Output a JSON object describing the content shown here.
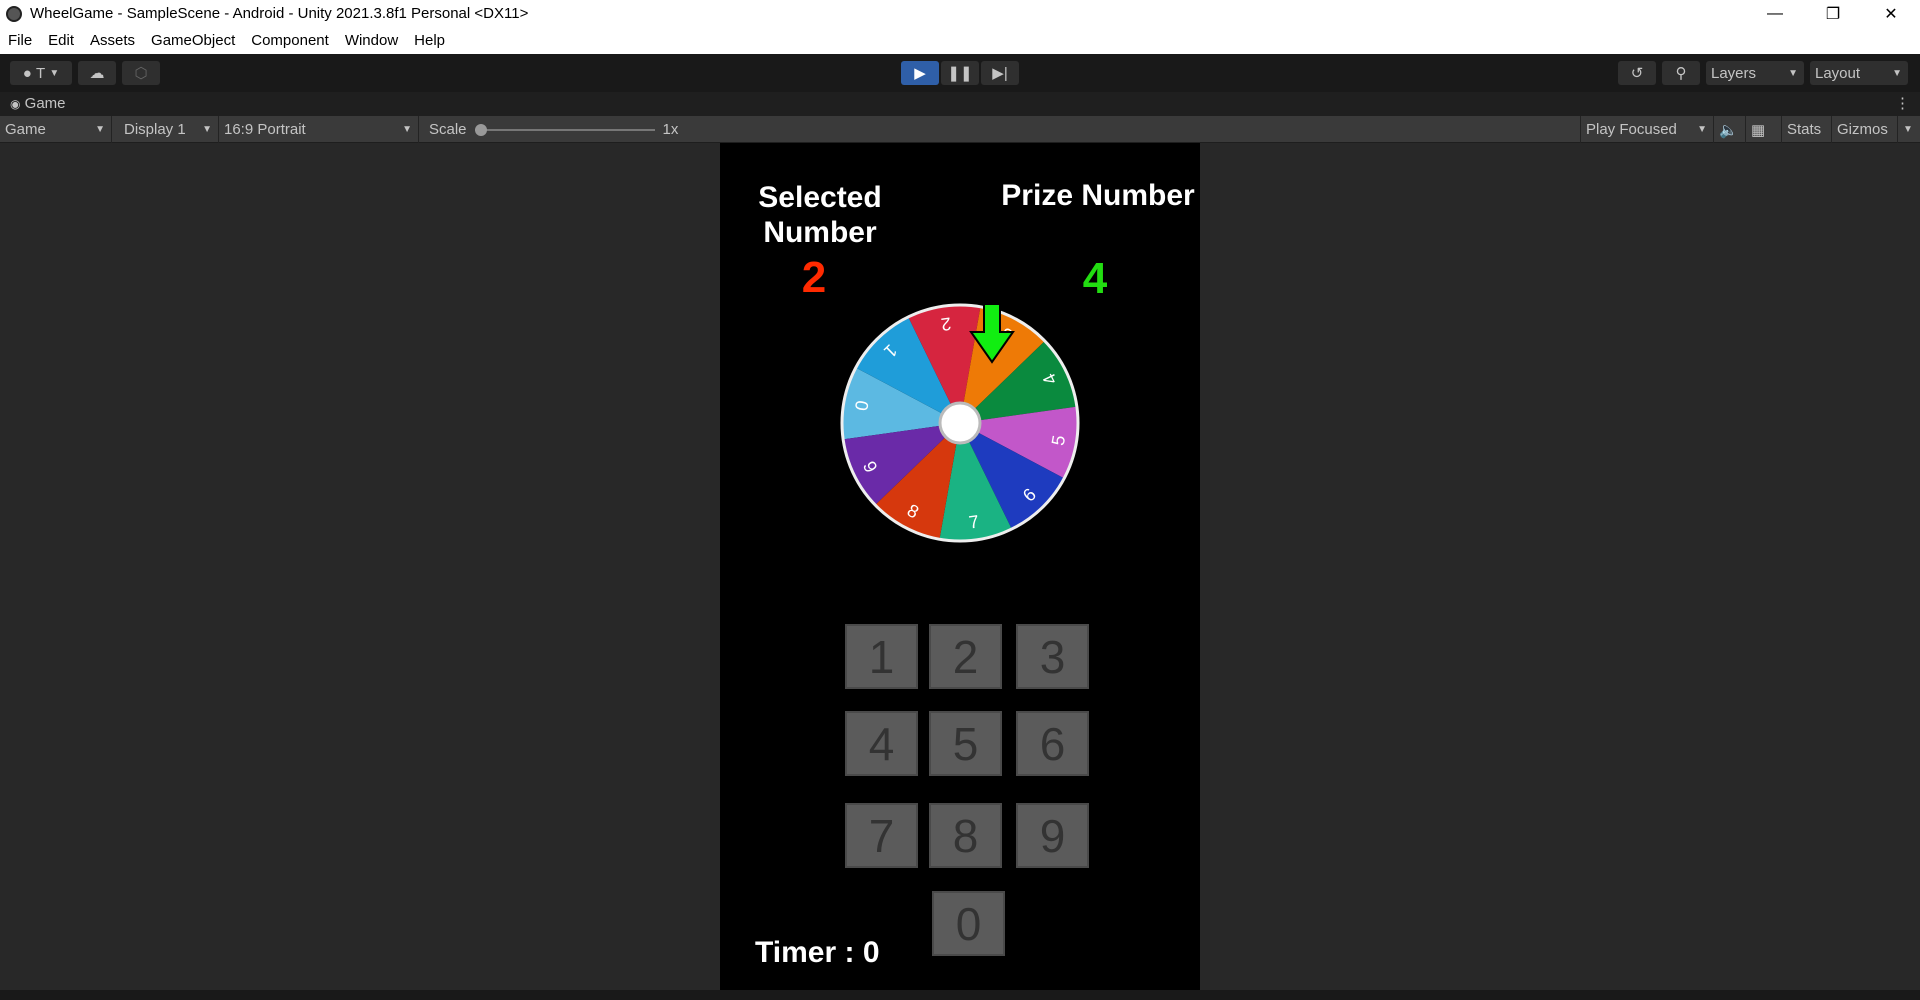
{
  "window": {
    "title": "WheelGame - SampleScene - Android - Unity 2021.3.8f1 Personal <DX11>"
  },
  "menu": [
    "File",
    "Edit",
    "Assets",
    "GameObject",
    "Component",
    "Window",
    "Help"
  ],
  "toolbar": {
    "account": "T",
    "layers": "Layers",
    "layout": "Layout"
  },
  "tab": {
    "label": "Game"
  },
  "game_toolbar": {
    "mode": "Game",
    "display": "Display 1",
    "aspect": "16:9 Portrait",
    "scale_label": "Scale",
    "scale_value": "1x",
    "play_focused": "Play Focused",
    "stats": "Stats",
    "gizmos": "Gizmos"
  },
  "game": {
    "selected_label": "Selected Number",
    "selected_value": "2",
    "prize_label": "Prize Number",
    "prize_value": "4",
    "timer": "Timer : 0",
    "wheel": {
      "labels": [
        "0",
        "1",
        "2",
        "3",
        "4",
        "5",
        "6",
        "7",
        "8",
        "9"
      ],
      "colors": [
        "#5cb9e2",
        "#1f9dd9",
        "#d6253f",
        "#ee7a06",
        "#0a8a3e",
        "#c257c9",
        "#1e3bbf",
        "#1ab383",
        "#d6380d",
        "#6a2aa8"
      ]
    },
    "keys": [
      "1",
      "2",
      "3",
      "4",
      "5",
      "6",
      "7",
      "8",
      "9",
      "0"
    ]
  },
  "colors": {
    "selected": "#ff2a00",
    "prize": "#22dd11",
    "arrow": "#11ee11",
    "play_active": "#2f5fa8"
  }
}
